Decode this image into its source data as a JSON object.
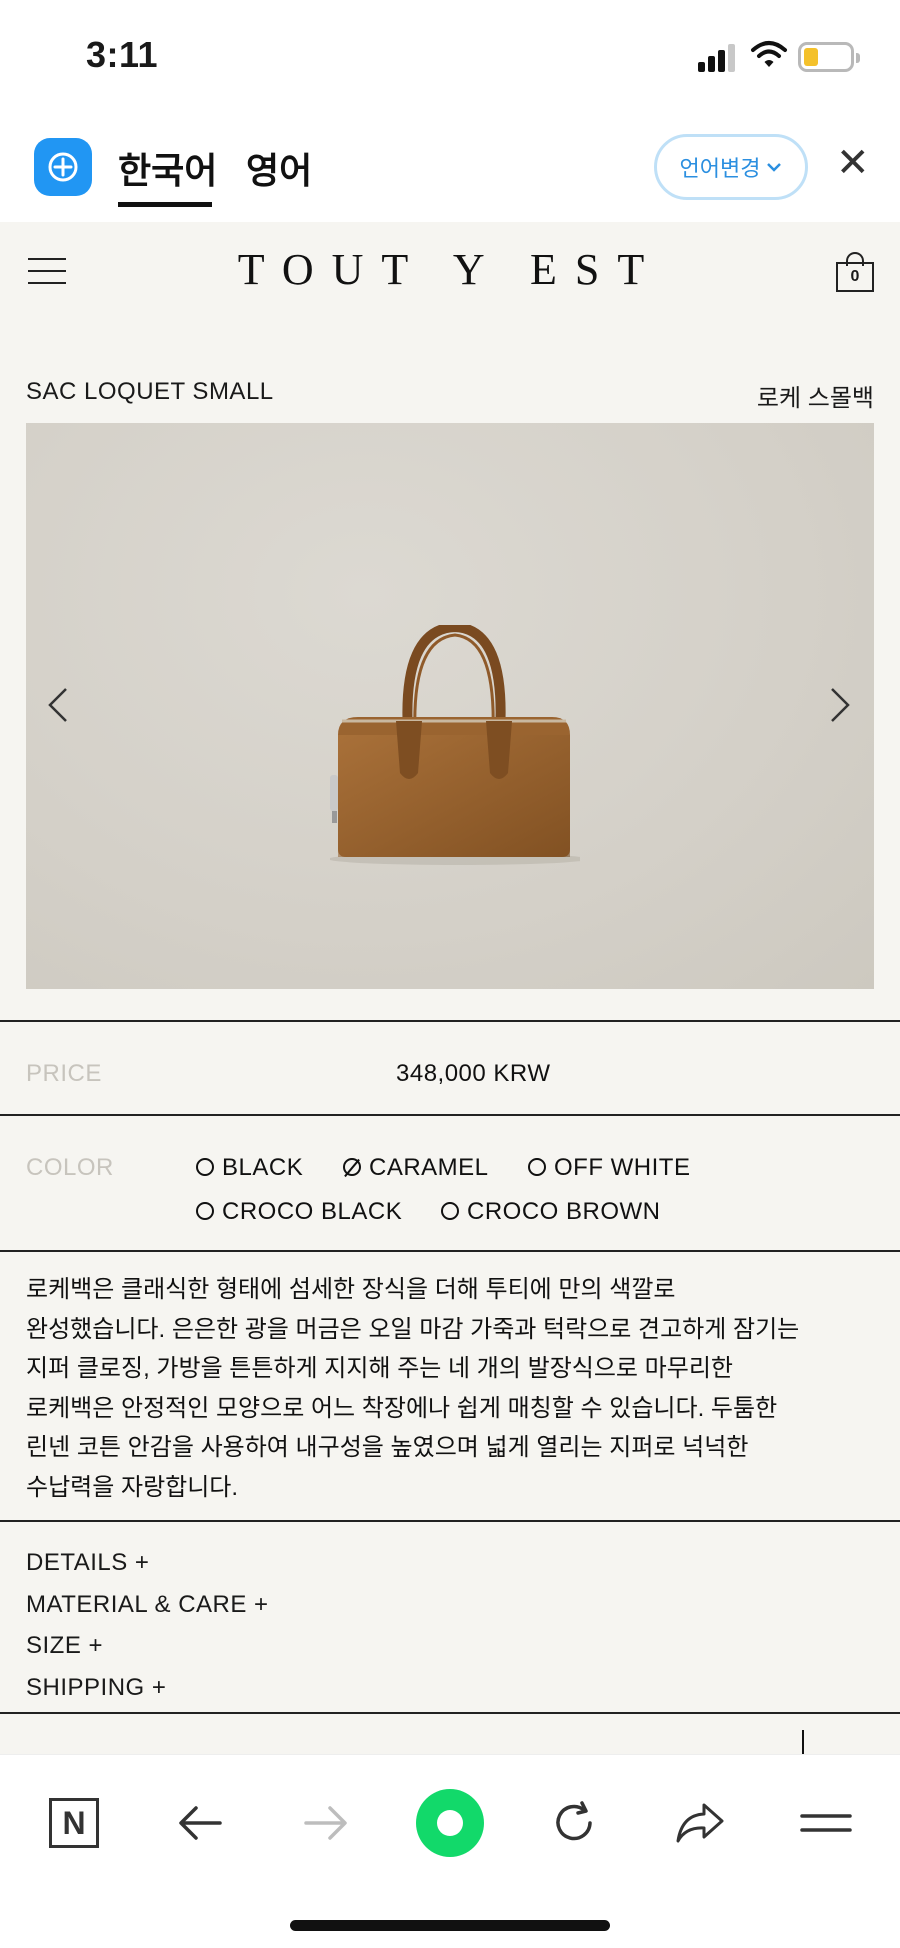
{
  "status_bar": {
    "time": "3:11"
  },
  "translation_bar": {
    "active_language": "한국어",
    "other_language": "영어",
    "change_language_label": "언어변경",
    "close_symbol": "✕"
  },
  "site": {
    "brand": "TOUT Y EST",
    "cart_count": "0"
  },
  "product": {
    "name": "SAC LOQUET SMALL",
    "name_ko": "로케 스몰백",
    "prev_arrow": "‹",
    "next_arrow": "›",
    "price_label": "PRICE",
    "price_value": "348,000 KRW",
    "color_label": "COLOR",
    "colors": [
      {
        "name": "BLACK",
        "selected": false
      },
      {
        "name": "CARAMEL",
        "selected": true
      },
      {
        "name": "OFF WHITE",
        "selected": false
      },
      {
        "name": "CROCO BLACK",
        "selected": false
      },
      {
        "name": "CROCO BROWN",
        "selected": false
      }
    ],
    "description_lines": [
      "로케백은 클래식한 형태에 섬세한 장식을 더해 투티에 만의 색깔로",
      "완성했습니다. 은은한 광을 머금은 오일 마감 가죽과 턱락으로 견고하게 잠기는",
      "지퍼 클로징, 가방을 튼튼하게 지지해 주는 네 개의 발장식으로 마무리한",
      "로케백은 안정적인 모양으로 어느 착장에나 쉽게 매칭할 수 있습니다. 두툼한",
      "린넨 코튼 안감을 사용하여 내구성을 높였으며 넓게 열리는 지퍼로 넉넉한",
      "수납력을 자랑합니다."
    ],
    "accordion": [
      "DETAILS +",
      "MATERIAL & CARE +",
      "SIZE +",
      "SHIPPING +"
    ]
  },
  "toolbar": {
    "naver_label": "N",
    "icons": [
      "naver-icon",
      "back-icon",
      "forward-icon",
      "green-dot-icon",
      "reload-icon",
      "share-icon",
      "menu-icon"
    ]
  },
  "colors": {
    "accent_blue": "#2196f3",
    "link_blue": "#2b8fe0",
    "page_bg": "#f6f5f1",
    "green_button": "#12d96a",
    "leather": "#9a6430"
  }
}
